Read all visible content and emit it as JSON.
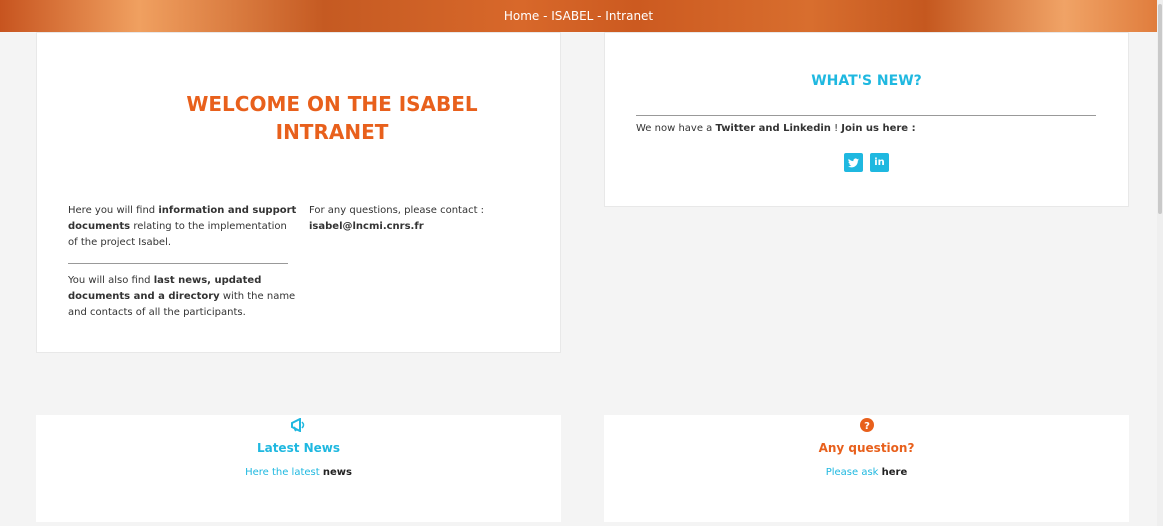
{
  "topbar": {
    "title": "Home - ISABEL - Intranet"
  },
  "welcome": {
    "title": "WELCOME ON THE ISABEL INTRANET",
    "col1_intro": "Here you will find ",
    "col1_bold": "information and support documents",
    "col1_rest": " relating to the implementation of the project Isabel.",
    "col2_intro": "You will also find ",
    "col2_bold": "last news, updated documents and a directory",
    "col2_rest": " with the name and contacts of all the participants.",
    "contact_text": "For any questions, please contact :",
    "contact_email": "isabel@lncmi.cnrs.fr"
  },
  "whats_new": {
    "title": "WHAT'S NEW?",
    "text_intro": "We now have a ",
    "text_bold1": "Twitter and Linkedin",
    "text_mid": " ! ",
    "text_bold2": "Join us here :",
    "twitter_icon": "twitter-icon",
    "linkedin_icon": "linkedin-icon"
  },
  "latest_news": {
    "icon": "megaphone-icon",
    "title": "Latest News",
    "text": "Here the latest ",
    "link": "news",
    "color": "#1fb8e0"
  },
  "any_question": {
    "icon": "question-icon",
    "title": "Any question?",
    "text": "Please ask ",
    "link": "here",
    "color": "#e8601c"
  },
  "colors": {
    "accent_orange": "#e8601c",
    "accent_blue": "#1fb8e0"
  }
}
